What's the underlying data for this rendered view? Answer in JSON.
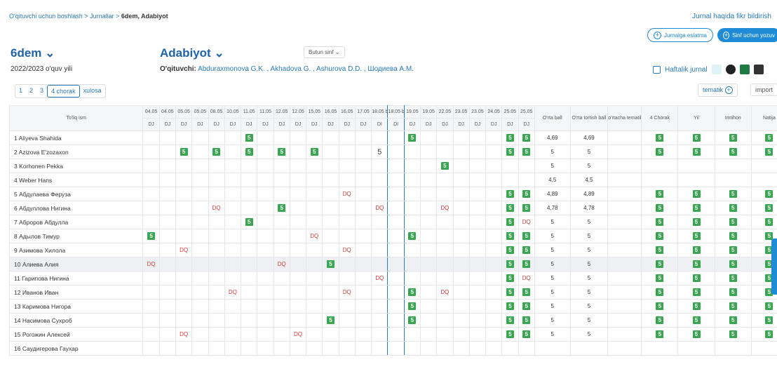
{
  "crumb": {
    "home": "O'qituvchi uchun boshlash",
    "sep": ">",
    "journals": "Jurnallar",
    "current": "6dem, Adabiyot"
  },
  "feedback": "Jurnal haqida fikr bildirish",
  "btn_remind": "Jurnalga eslatma",
  "btn_write": "Sinf uchun yozuv",
  "class": "6dem ⌄",
  "year": "2022/2023 o'quv yili",
  "subject": "Adabiyot ⌄",
  "group_select": "Butun sinf ⌄",
  "teacher_label": "O'qituvchi:",
  "teachers": "Abduraxmonova G.K. ,  Akhadova G. ,  Ashurova D.D. ,  Шодиева А.М.",
  "weekly": "Haftalik jurnal",
  "tabs": [
    "1",
    "2",
    "3",
    "4 chorak",
    "xulosa"
  ],
  "tematik": "tematik",
  "import": "import",
  "headers": {
    "name": "To'liq ism",
    "avg": "O'rta ball",
    "wavg": "O'rta tortish ball",
    "tem": "o'rtacha tematika",
    "q4": "4 Chorak",
    "yil": "Yil",
    "imt": "Imtihon",
    "nat": "Natija"
  },
  "dates": [
    "04.05",
    "04.05",
    "05.05",
    "05.05",
    "08.05",
    "10.05",
    "11.05",
    "11.05",
    "12.05",
    "12.05",
    "15.05",
    "16.05",
    "16.05",
    "17.05",
    "18.05 bugun",
    "18.05 bugun",
    "19.05",
    "19.05",
    "22.05",
    "23.05",
    "23.05",
    "24.05",
    "25.05",
    "25.05"
  ],
  "dtype": [
    "DJ",
    "DJ",
    "DJ",
    "DJ",
    "DJ",
    "DJ",
    "DJ",
    "DJ",
    "DJ",
    "DJ",
    "DJ",
    "DJ",
    "DJ",
    "DJ",
    "DI",
    "DI",
    "DJ",
    "DJ",
    "DJ",
    "DJ",
    "DJ",
    "DJ",
    "DJ",
    "DJ"
  ],
  "rows": [
    {
      "n": "1  Aliyeva Shahida",
      "avg": "4,69",
      "w": "4,69",
      "m": {
        "6": "5",
        "16": "5",
        "22": "5",
        "23": "5"
      },
      "f": true
    },
    {
      "n": "2  Azizova E'zozaxon",
      "avg": "5",
      "w": "5",
      "m": {
        "2": "5",
        "4": "5",
        "6": "5",
        "8": "5",
        "10": "5",
        "14": "5p",
        "22": "5",
        "23": "5"
      },
      "f": true
    },
    {
      "n": "3  Korhonen Pekka",
      "avg": "5",
      "w": "5",
      "m": {
        "18": "5"
      },
      "f": false
    },
    {
      "n": "4  Weber Hans",
      "avg": "4,5",
      "w": "4,5",
      "m": {},
      "f": false
    },
    {
      "n": "5  Абдулаева Феруза",
      "avg": "4,89",
      "w": "4,89",
      "m": {
        "12": "DQ",
        "22": "5",
        "23": "5"
      },
      "f": true
    },
    {
      "n": "6  Абдуллова Нигина",
      "avg": "4,78",
      "w": "4,78",
      "m": {
        "4": "DQ",
        "8": "5",
        "14": "DQ",
        "18": "DQ",
        "22": "5",
        "23": "5"
      },
      "f": true
    },
    {
      "n": "7  Аброров Абдулла",
      "avg": "5",
      "w": "5",
      "m": {
        "6": "5",
        "22": "5",
        "23": "DQ"
      },
      "f": true
    },
    {
      "n": "8  Адылов Тимур",
      "avg": "5",
      "w": "5",
      "m": {
        "0": "5",
        "10": "DQ",
        "16": "5",
        "22": "5",
        "23": "5"
      },
      "f": true
    },
    {
      "n": "9  Азимова Хилола",
      "avg": "5",
      "w": "5",
      "m": {
        "2": "DQ",
        "12": "DQ",
        "22": "5",
        "23": "5"
      },
      "f": true
    },
    {
      "n": "10  Алиева Алия",
      "avg": "5",
      "w": "5",
      "m": {
        "0": "DQ",
        "8": "DQ",
        "11": "5",
        "22": "5",
        "23": "5"
      },
      "f": true,
      "hl": true
    },
    {
      "n": "11  Гарипова Нигина",
      "avg": "5",
      "w": "5",
      "m": {
        "14": "DQ",
        "22": "5",
        "23": "DQ"
      },
      "f": true
    },
    {
      "n": "12  Иванов Иван",
      "avg": "5",
      "w": "5",
      "m": {
        "5": "DQ",
        "12": "DQ",
        "16": "5",
        "18": "DQ",
        "22": "5",
        "23": "5"
      },
      "f": true
    },
    {
      "n": "13  Каримова Нигора",
      "avg": "5",
      "w": "5",
      "m": {
        "16": "5",
        "22": "5",
        "23": "5"
      },
      "f": true
    },
    {
      "n": "14  Насимова Сухроб",
      "avg": "5",
      "w": "5",
      "m": {
        "11": "5",
        "16": "5",
        "22": "5",
        "23": "5"
      },
      "f": true
    },
    {
      "n": "15  Рогожин Алексей",
      "avg": "5",
      "w": "5",
      "m": {
        "2": "DQ",
        "9": "DQ",
        "22": "5",
        "23": "5"
      },
      "f": true
    },
    {
      "n": "16  Саудигерова Гаухар",
      "avg": "",
      "w": "",
      "m": {},
      "f": false
    }
  ],
  "final_grade": "5"
}
